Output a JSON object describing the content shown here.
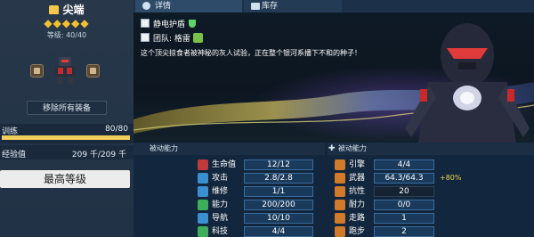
{
  "unit": {
    "name": "尖端",
    "stars": "◆◆◆◆◆",
    "level_label": "等级",
    "level_value": "40/40",
    "remove_all_label": "移除所有装备"
  },
  "training": {
    "label": "训练",
    "value": "80/80",
    "progress": 1.0
  },
  "experience": {
    "label": "经验值",
    "value": "209 千/209 千"
  },
  "max_level_label": "最高等级",
  "tabs": [
    {
      "label": "详情",
      "icon": "person-icon"
    },
    {
      "label": "库存",
      "icon": "shirt-icon"
    }
  ],
  "abilities": [
    {
      "label": "静电护盾",
      "icon": "shield-icon"
    },
    {
      "label": "团队: 格雷",
      "icon": "team-icon"
    }
  ],
  "description": "这个顶尖掠食者被神秘的灰人试验，正在整个银河系播下不和的种子！",
  "passive": {
    "left_header": "被动能力",
    "right_header": "被动能力"
  },
  "stats_left": [
    {
      "label": "生命值",
      "value": "12/12",
      "icon": "heart-icon",
      "color": "#c0393b"
    },
    {
      "label": "攻击",
      "value": "2.8/2.8",
      "icon": "sword-icon",
      "color": "#3a8fd0"
    },
    {
      "label": "维修",
      "value": "1/1",
      "icon": "wrench-icon",
      "color": "#3a8fd0"
    },
    {
      "label": "能力",
      "value": "200/200",
      "icon": "person-icon",
      "color": "#3fae5a"
    },
    {
      "label": "导航",
      "value": "10/10",
      "icon": "compass-icon",
      "color": "#3a8fd0"
    },
    {
      "label": "科技",
      "value": "4/4",
      "icon": "chip-icon",
      "color": "#3fae5a"
    }
  ],
  "stats_right": [
    {
      "label": "引擎",
      "value": "4/4",
      "icon": "engine-icon",
      "color": "#d07a2a",
      "dark": false
    },
    {
      "label": "武器",
      "value": "64.3/64.3",
      "icon": "crosshair-icon",
      "color": "#d07a2a",
      "dark": false,
      "bonus": "+80%"
    },
    {
      "label": "抗性",
      "value": "20",
      "icon": "drop-icon",
      "color": "#d07a2a",
      "dark": true
    },
    {
      "label": "耐力",
      "value": "0/0",
      "icon": "flask-icon",
      "color": "#d07a2a",
      "dark": false
    },
    {
      "label": "走路",
      "value": "1",
      "icon": "walk-icon",
      "color": "#d07a2a",
      "dark": false
    },
    {
      "label": "跑步",
      "value": "2",
      "icon": "run-icon",
      "color": "#d07a2a",
      "dark": false
    }
  ]
}
